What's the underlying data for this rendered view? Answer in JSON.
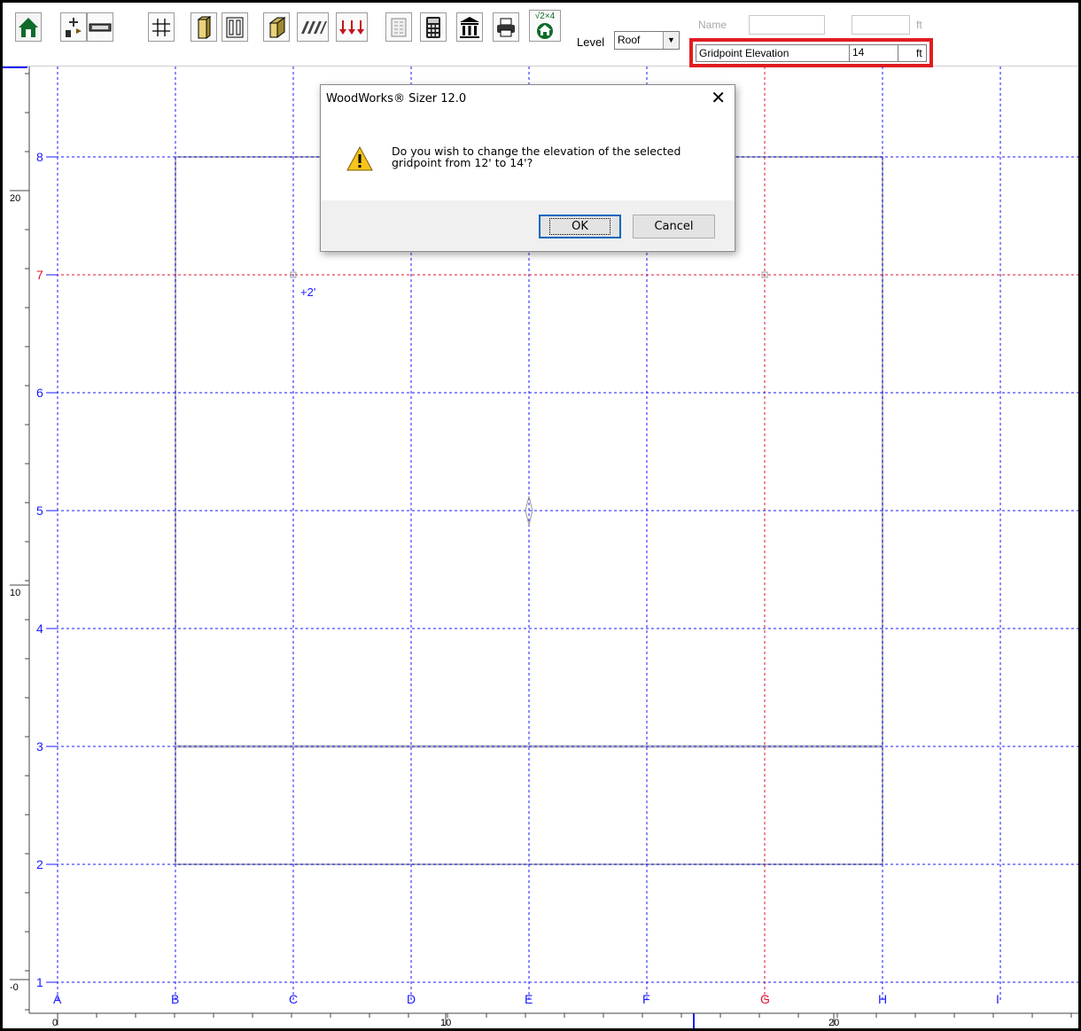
{
  "toolbar": {
    "buttons": [
      {
        "name": "home-icon"
      },
      {
        "name": "layout-generate-icon"
      },
      {
        "name": "beam-icon"
      },
      {
        "name": "grid-icon"
      },
      {
        "name": "column-icon"
      },
      {
        "name": "wall-icon"
      },
      {
        "name": "post-icon"
      },
      {
        "name": "joists-icon"
      },
      {
        "name": "loads-icon"
      },
      {
        "name": "report-icon"
      },
      {
        "name": "calculator-icon"
      },
      {
        "name": "building-icon"
      },
      {
        "name": "printer-icon"
      },
      {
        "name": "design-2x4-icon",
        "badge": "√2×4"
      }
    ],
    "level_label": "Level",
    "level_value": "Roof",
    "name_label": "Name",
    "name_value": "",
    "name_unit_value": "",
    "name_unit": "ft",
    "gridpoint_label": "Gridpoint Elevation",
    "gridpoint_value": "14",
    "gridpoint_unit": "ft"
  },
  "grid": {
    "vertical_lines": [
      {
        "label": "A",
        "color": "#1a1aff"
      },
      {
        "label": "B",
        "color": "#1a1aff"
      },
      {
        "label": "C",
        "color": "#1a1aff"
      },
      {
        "label": "D",
        "color": "#1a1aff"
      },
      {
        "label": "E",
        "color": "#1a1aff"
      },
      {
        "label": "F",
        "color": "#1a1aff"
      },
      {
        "label": "G",
        "color": "#e0102c"
      },
      {
        "label": "H",
        "color": "#1a1aff"
      },
      {
        "label": "I",
        "color": "#1a1aff"
      }
    ],
    "horizontal_lines": [
      {
        "label": "8",
        "color": "#1a1aff"
      },
      {
        "label": "7",
        "color": "#e0102c"
      },
      {
        "label": "6",
        "color": "#1a1aff"
      },
      {
        "label": "5",
        "color": "#1a1aff"
      },
      {
        "label": "4",
        "color": "#1a1aff"
      },
      {
        "label": "3",
        "color": "#1a1aff"
      },
      {
        "label": "2",
        "color": "#1a1aff"
      },
      {
        "label": "1",
        "color": "#1a1aff"
      }
    ],
    "elevation_marker": "+2'",
    "ruler_bottom_labels": [
      "0",
      "10",
      "20"
    ],
    "ruler_left_labels": [
      "20",
      "10",
      "-0"
    ]
  },
  "dialog": {
    "title": "WoodWorks® Sizer 12.0",
    "message_line1": "Do you wish to change the elevation of the selected",
    "message_line2": "gridpoint from 12' to 14'?",
    "ok_label": "OK",
    "cancel_label": "Cancel",
    "close_glyph": "✕"
  }
}
